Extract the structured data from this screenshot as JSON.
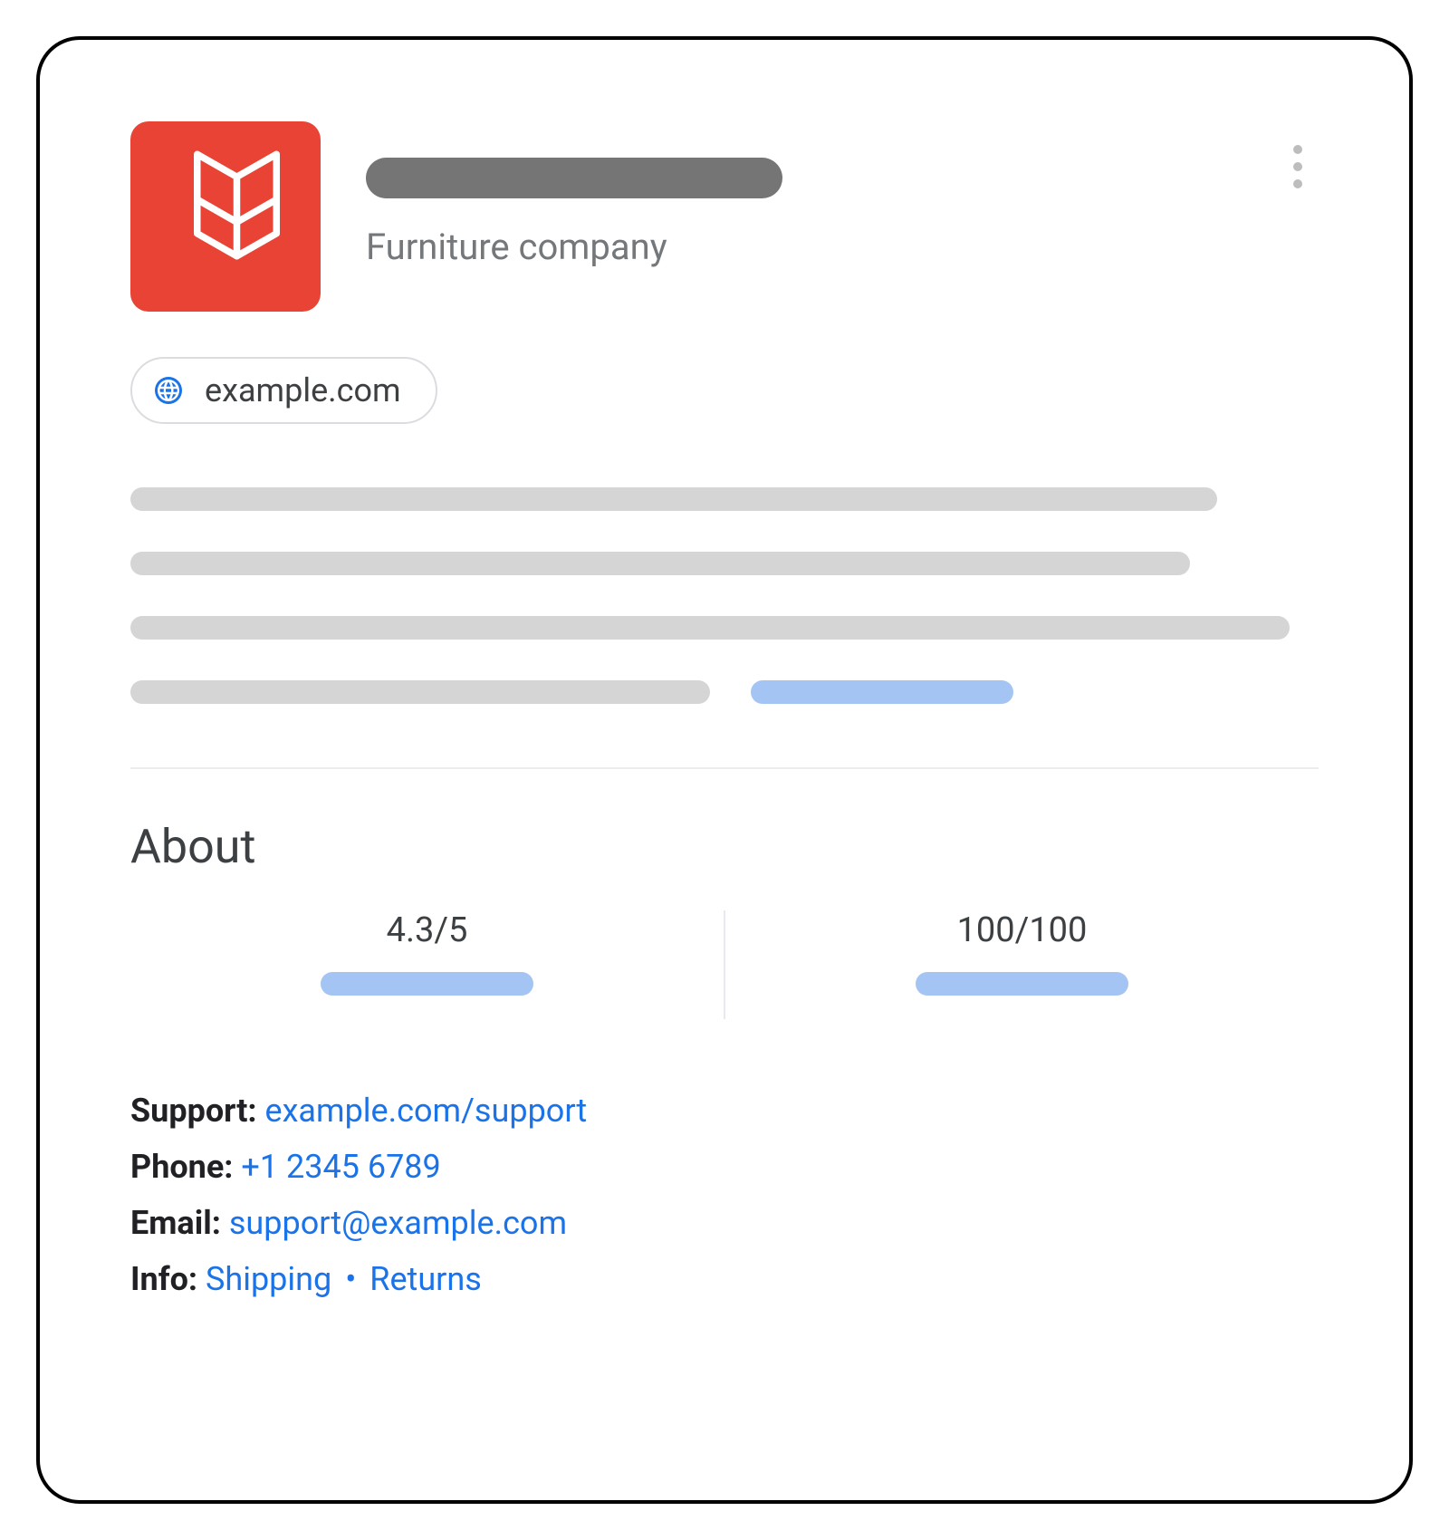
{
  "header": {
    "subtitle": "Furniture company",
    "website_chip": "example.com"
  },
  "about": {
    "heading": "About",
    "rating_value": "4.3/5",
    "score_value": "100/100"
  },
  "contact": {
    "support_label": "Support:",
    "support_link": "example.com/support",
    "phone_label": "Phone:",
    "phone_link": "+1 2345 6789",
    "email_label": "Email:",
    "email_link": "support@example.com",
    "info_label": "Info:",
    "info_shipping": "Shipping",
    "info_returns": "Returns",
    "info_separator": "•"
  }
}
